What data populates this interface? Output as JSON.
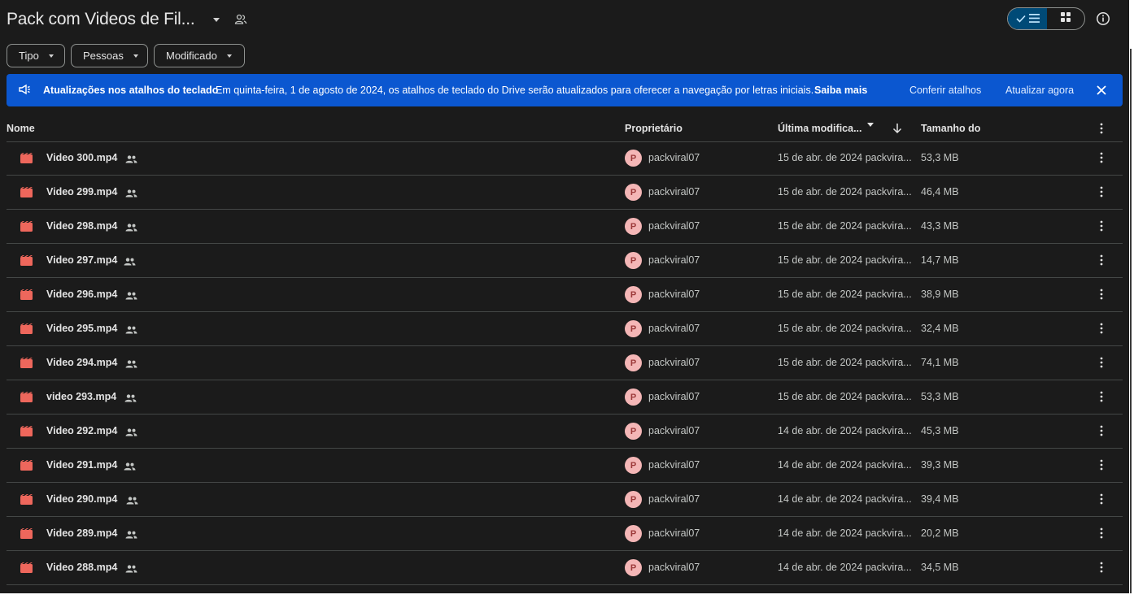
{
  "header": {
    "title": "Pack com Videos de Fil...",
    "view_list_label": "✓",
    "view_grid_label": "grid"
  },
  "filters": [
    {
      "label": "Tipo"
    },
    {
      "label": "Pessoas"
    },
    {
      "label": "Modificado"
    }
  ],
  "banner": {
    "title": "Atualizações nos atalhos do teclado",
    "message": "Em quinta-feira, 1 de agosto de 2024, os atalhos de teclado do Drive serão atualizados para oferecer a navegação por letras iniciais.",
    "learn_more": "Saiba mais",
    "action_check": "Conferir atalhos",
    "action_update": "Atualizar agora",
    "accent": "#0b57d0"
  },
  "table": {
    "columns": {
      "name": "Nome",
      "owner": "Proprietário",
      "modified": "Última modifica...",
      "size": "Tamanho do"
    },
    "rows": [
      {
        "name": "Video 300.mp4",
        "owner_initial": "P",
        "owner": "packviral07",
        "modified": "15 de abr. de 2024 packvira...",
        "size": "53,3 MB"
      },
      {
        "name": "Video 299.mp4",
        "owner_initial": "P",
        "owner": "packviral07",
        "modified": "15 de abr. de 2024 packvira...",
        "size": "46,4 MB"
      },
      {
        "name": "Video 298.mp4",
        "owner_initial": "P",
        "owner": "packviral07",
        "modified": "15 de abr. de 2024 packvira...",
        "size": "43,3 MB"
      },
      {
        "name": "Video 297.mp4",
        "owner_initial": "P",
        "owner": "packviral07",
        "modified": "15 de abr. de 2024 packvira...",
        "size": "14,7 MB"
      },
      {
        "name": "Video 296.mp4",
        "owner_initial": "P",
        "owner": "packviral07",
        "modified": "15 de abr. de 2024 packvira...",
        "size": "38,9 MB"
      },
      {
        "name": "Video 295.mp4",
        "owner_initial": "P",
        "owner": "packviral07",
        "modified": "15 de abr. de 2024 packvira...",
        "size": "32,4 MB"
      },
      {
        "name": "Video 294.mp4",
        "owner_initial": "P",
        "owner": "packviral07",
        "modified": "15 de abr. de 2024 packvira...",
        "size": "74,1 MB"
      },
      {
        "name": "video 293.mp4",
        "owner_initial": "P",
        "owner": "packviral07",
        "modified": "15 de abr. de 2024 packvira...",
        "size": "53,3 MB"
      },
      {
        "name": "Video 292.mp4",
        "owner_initial": "P",
        "owner": "packviral07",
        "modified": "14 de abr. de 2024 packvira...",
        "size": "45,3 MB"
      },
      {
        "name": "Video 291.mp4",
        "owner_initial": "P",
        "owner": "packviral07",
        "modified": "14 de abr. de 2024 packvira...",
        "size": "39,3 MB"
      },
      {
        "name": "Video 290.mp4",
        "owner_initial": "P",
        "owner": "packviral07",
        "modified": "14 de abr. de 2024 packvira...",
        "size": "39,4 MB"
      },
      {
        "name": "Video 289.mp4",
        "owner_initial": "P",
        "owner": "packviral07",
        "modified": "14 de abr. de 2024 packvira...",
        "size": "20,2 MB"
      },
      {
        "name": "Video 288.mp4",
        "owner_initial": "P",
        "owner": "packviral07",
        "modified": "14 de abr. de 2024 packvira...",
        "size": "34,5 MB"
      }
    ]
  },
  "icons": {
    "file": "video-file-icon",
    "shared": "shared-people-icon",
    "more": "more-vert-icon"
  },
  "colors": {
    "background": "#1b1b1b",
    "video_icon": "#ee675c",
    "avatar_bg": "#f4b6b6"
  }
}
